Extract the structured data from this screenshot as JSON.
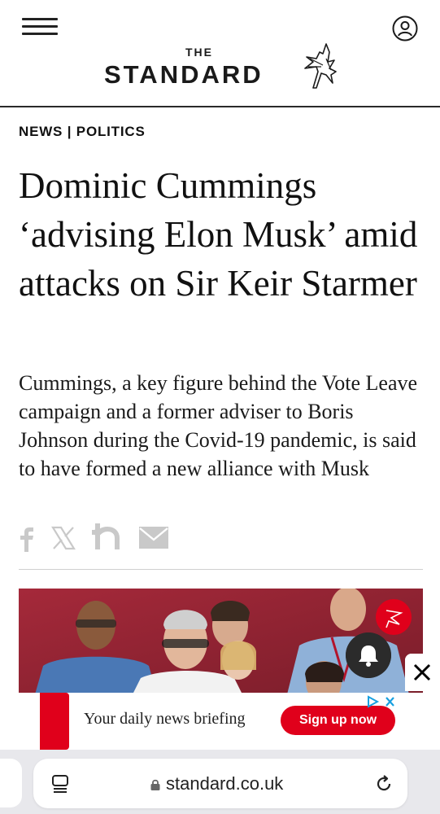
{
  "header": {
    "logo_the": "THE",
    "logo_main": "STANDARD",
    "menu_icon": "hamburger-menu-icon",
    "account_icon": "account-icon"
  },
  "article": {
    "kicker": "NEWS | POLITICS",
    "headline": "Dominic Cummings ‘advising Elon Musk’ amid attacks on Sir Keir Starmer",
    "standfirst": "Cummings, a key figure behind the Vote Leave campaign and a former adviser to Boris Johnson during the Covid-19 pandemic, is said to have formed a new alliance with Musk",
    "share_icons": [
      "facebook-icon",
      "x-icon",
      "nextdoor-icon",
      "email-icon"
    ]
  },
  "ad": {
    "text": "Your daily news briefing",
    "button_label": "Sign up now",
    "accent_color": "#e0001b"
  },
  "browser": {
    "url": "standard.co.uk"
  },
  "colors": {
    "brand_red": "#e0001b",
    "hero_background": "#8f2433",
    "text": "#111111"
  }
}
